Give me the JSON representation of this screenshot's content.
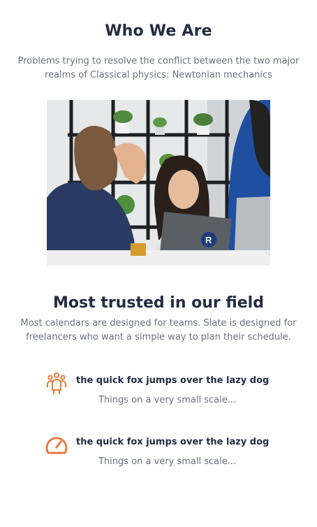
{
  "who": {
    "title": "Who We Are",
    "description": "Problems trying to resolve the conflict between the two major realms of Classical physics: Newtonian mechanics"
  },
  "trusted": {
    "title": "Most trusted in our field",
    "description": "Most calendars are designed for teams. Slate is designed for freelancers who want a simple way to plan their schedule."
  },
  "features": [
    {
      "icon": "team-icon",
      "title": "the quick fox jumps over the lazy dog",
      "description": "Things on a very small scale..."
    },
    {
      "icon": "speedometer-icon",
      "title": "the quick fox jumps over the lazy dog",
      "description": "Things on a very small scale..."
    }
  ],
  "colors": {
    "heading": "#252b42",
    "body": "#6b6f7a",
    "accent": "#e77c40"
  }
}
